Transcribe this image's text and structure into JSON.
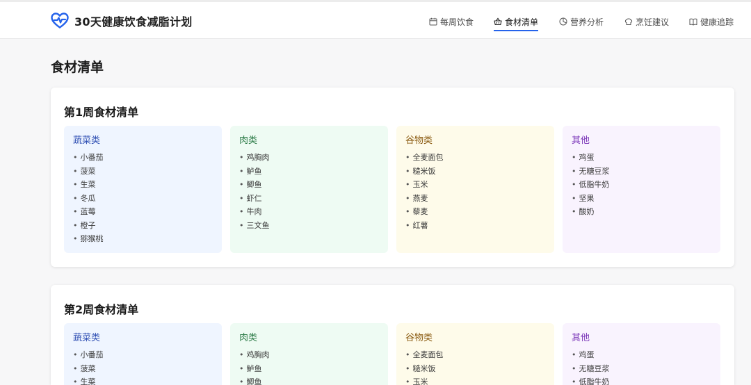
{
  "header": {
    "title": "30天健康饮食减脂计划",
    "logo_icon": "heart-pulse-icon",
    "brand_color": "#2563eb",
    "nav": [
      {
        "label": "每周饮食",
        "icon": "calendar-icon",
        "active": false
      },
      {
        "label": "食材清单",
        "icon": "basket-icon",
        "active": true
      },
      {
        "label": "营养分析",
        "icon": "pie-chart-icon",
        "active": false
      },
      {
        "label": "烹饪建议",
        "icon": "chef-hat-icon",
        "active": false
      },
      {
        "label": "健康追踪",
        "icon": "book-icon",
        "active": false
      }
    ]
  },
  "page_title": "食材清单",
  "weeks": [
    {
      "title": "第1周食材清单",
      "categories": [
        {
          "name": "蔬菜类",
          "items": [
            "小番茄",
            "菠菜",
            "生菜",
            "冬瓜",
            "蓝莓",
            "橙子",
            "猕猴桃"
          ]
        },
        {
          "name": "肉类",
          "items": [
            "鸡胸肉",
            "鲈鱼",
            "鲫鱼",
            "虾仁",
            "牛肉",
            "三文鱼"
          ]
        },
        {
          "name": "谷物类",
          "items": [
            "全麦面包",
            "糙米饭",
            "玉米",
            "燕麦",
            "藜麦",
            "红薯"
          ]
        },
        {
          "name": "其他",
          "items": [
            "鸡蛋",
            "无糖豆浆",
            "低脂牛奶",
            "坚果",
            "酸奶"
          ]
        }
      ]
    },
    {
      "title": "第2周食材清单",
      "categories": [
        {
          "name": "蔬菜类",
          "items": [
            "小番茄",
            "菠菜",
            "生菜"
          ]
        },
        {
          "name": "肉类",
          "items": [
            "鸡胸肉",
            "鲈鱼",
            "鲫鱼"
          ]
        },
        {
          "name": "谷物类",
          "items": [
            "全麦面包",
            "糙米饭",
            "玉米"
          ]
        },
        {
          "name": "其他",
          "items": [
            "鸡蛋",
            "无糖豆浆",
            "低脂牛奶"
          ]
        }
      ]
    }
  ]
}
